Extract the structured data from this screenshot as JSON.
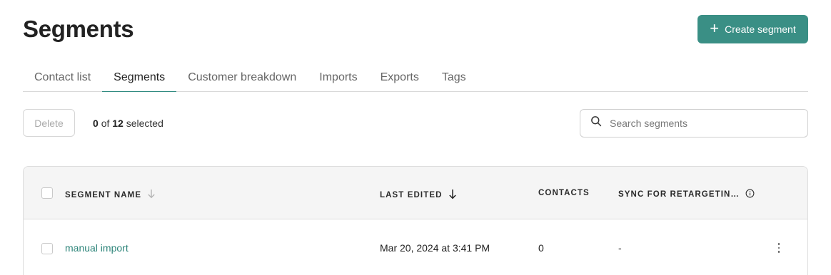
{
  "page": {
    "title": "Segments"
  },
  "header": {
    "create_button_label": "Create segment"
  },
  "tabs": [
    {
      "label": "Contact list",
      "active": false
    },
    {
      "label": "Segments",
      "active": true
    },
    {
      "label": "Customer breakdown",
      "active": false
    },
    {
      "label": "Imports",
      "active": false
    },
    {
      "label": "Exports",
      "active": false
    },
    {
      "label": "Tags",
      "active": false
    }
  ],
  "toolbar": {
    "delete_label": "Delete",
    "selected_count": "0",
    "selected_of": "of",
    "total_count": "12",
    "selected_suffix": "selected",
    "search_placeholder": "Search segments"
  },
  "table": {
    "columns": {
      "name": "SEGMENT NAME",
      "last_edited": "LAST EDITED",
      "contacts": "CONTACTS",
      "sync": "SYNC FOR RETARGETIN…"
    },
    "rows": [
      {
        "name": "manual import",
        "last_edited": "Mar 20, 2024 at 3:41 PM",
        "contacts": "0",
        "sync": "-"
      }
    ]
  },
  "colors": {
    "accent": "#3a8f85",
    "link": "#2c8479"
  },
  "icons": [
    "plus-icon",
    "search-icon",
    "sort-down-icon",
    "info-icon",
    "more-vertical-icon"
  ]
}
